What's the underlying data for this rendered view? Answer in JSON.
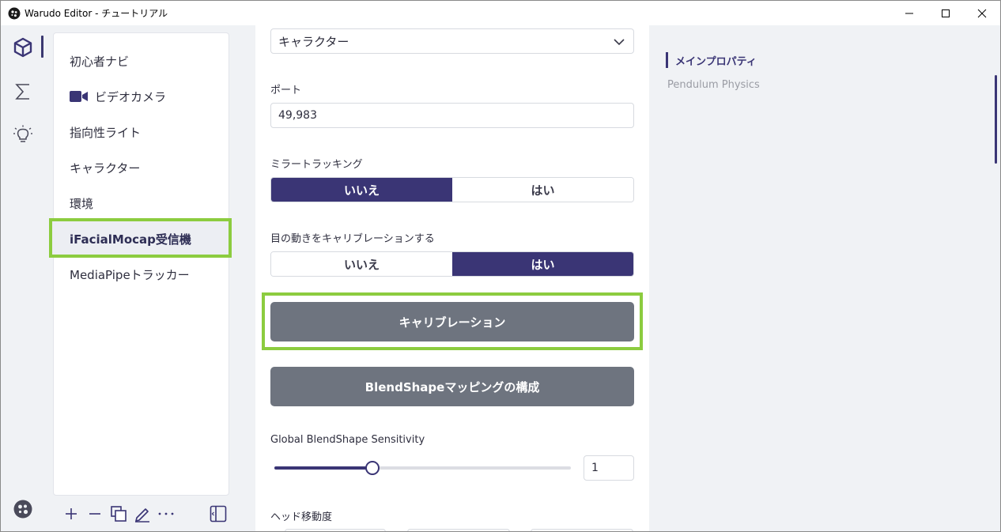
{
  "window": {
    "title": "Warudo Editor - チュートリアル"
  },
  "sidebar": {
    "items": [
      {
        "label": "初心者ナビ"
      },
      {
        "label": "ビデオカメラ",
        "icon": "video-camera-icon"
      },
      {
        "label": "指向性ライト"
      },
      {
        "label": "キャラクター"
      },
      {
        "label": "環境"
      },
      {
        "label": "iFacialMocap受信機",
        "selected": true
      },
      {
        "label": "MediaPipeトラッカー"
      }
    ]
  },
  "main": {
    "character_select": {
      "value": "キャラクター"
    },
    "port": {
      "label": "ポート",
      "value": "49,983"
    },
    "mirror_tracking": {
      "label": "ミラートラッキング",
      "options": [
        "いいえ",
        "はい"
      ],
      "selected": "いいえ"
    },
    "eye_calibration": {
      "label": "目の動きをキャリブレーションする",
      "options": [
        "いいえ",
        "はい"
      ],
      "selected": "はい"
    },
    "calibrate_button": "キャリブレーション",
    "blendshape_button": "BlendShapeマッピングの構成",
    "sensitivity": {
      "label": "Global BlendShape Sensitivity",
      "value": "1",
      "fraction": 0.33
    },
    "head_movement": {
      "label": "ヘッド移動度"
    }
  },
  "toc": {
    "active": "メインプロパティ",
    "items": [
      "Pendulum Physics"
    ]
  },
  "colors": {
    "accent": "#3a3575",
    "highlight": "#8ccc3f",
    "button_gray": "#6e747f"
  }
}
